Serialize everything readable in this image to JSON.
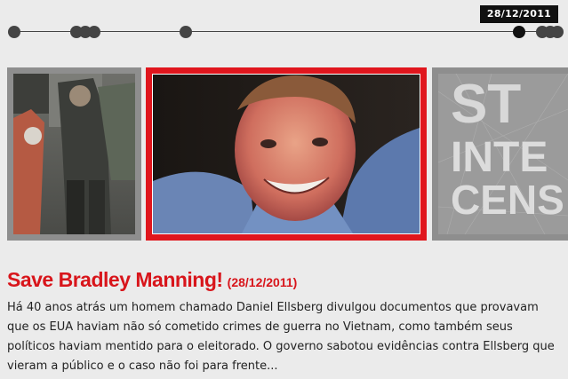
{
  "timeline": {
    "active_date": "28/12/2011",
    "dot_count": 9
  },
  "slides": {
    "left_image": "protest-photo",
    "center_image": "bradley-manning-portrait",
    "right_image": "stop-internet-censorship-poster",
    "right_text": [
      "ST",
      "INTE",
      "CENS"
    ]
  },
  "article": {
    "title": "Save Bradley Manning!",
    "date": "(28/12/2011)",
    "excerpt": "Há 40 anos atrás um homem chamado Daniel Ellsberg divulgou documentos que provavam que os EUA haviam não só cometido crimes de guerra no Vietnam, como também seus políticos haviam mentido para o eleitorado. O governo sabotou evidências contra Ellsberg que vieram a público e o caso não foi para frente..."
  },
  "colors": {
    "accent": "#e0161d",
    "background": "#ebebeb",
    "badge": "#111111"
  }
}
